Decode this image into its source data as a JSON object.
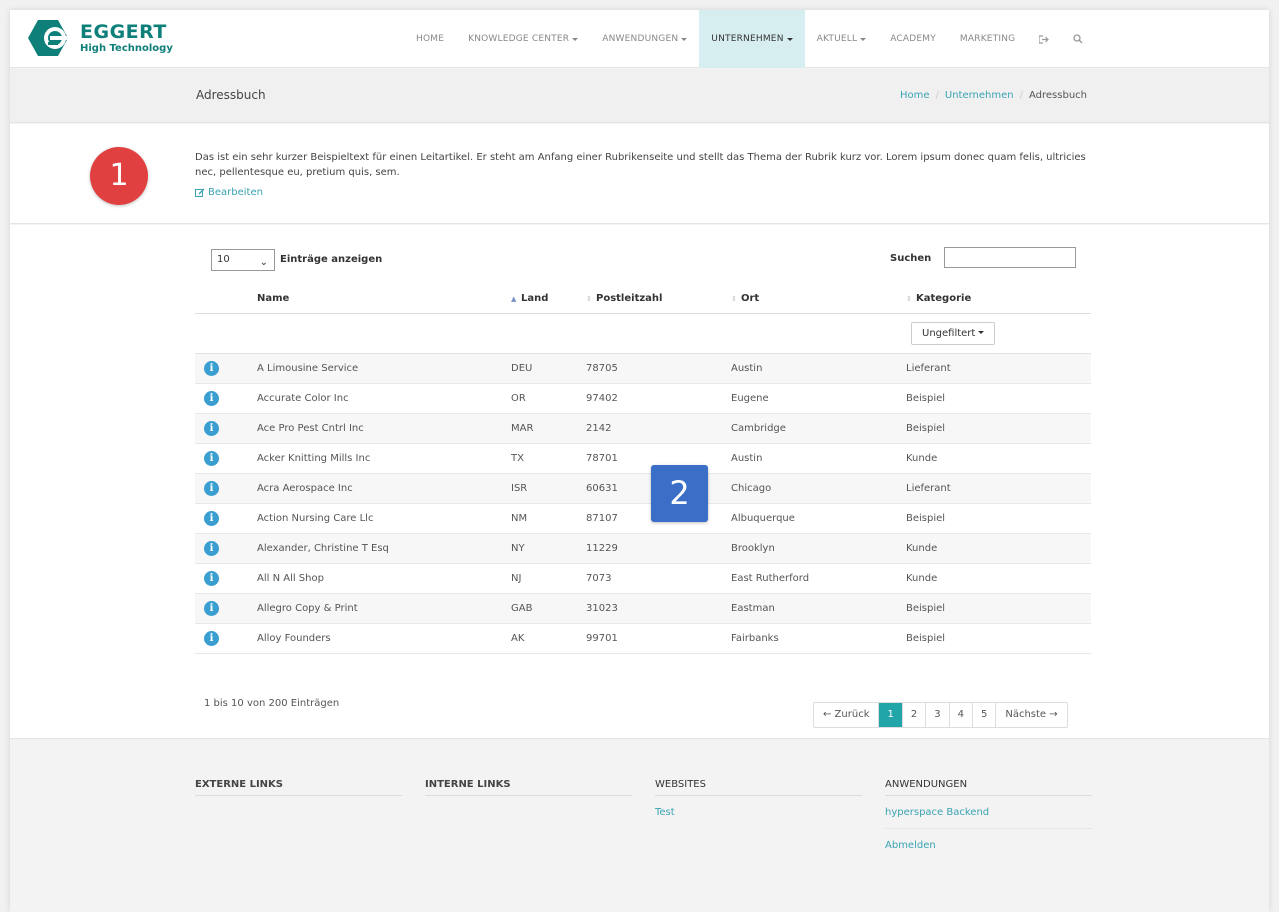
{
  "brand": {
    "name": "EGGERT",
    "tagline": "High Technology",
    "color": "#0f7f7a"
  },
  "nav": {
    "items": [
      {
        "label": "HOME",
        "dropdown": false,
        "active": false
      },
      {
        "label": "KNOWLEDGE CENTER",
        "dropdown": true,
        "active": false
      },
      {
        "label": "ANWENDUNGEN",
        "dropdown": true,
        "active": false
      },
      {
        "label": "UNTERNEHMEN",
        "dropdown": true,
        "active": true
      },
      {
        "label": "AKTUELL",
        "dropdown": true,
        "active": false
      },
      {
        "label": "ACADEMY",
        "dropdown": false,
        "active": false
      },
      {
        "label": "MARKETING",
        "dropdown": false,
        "active": false
      }
    ],
    "icons": [
      "sign-out-icon",
      "search-icon"
    ]
  },
  "header": {
    "title": "Adressbuch",
    "breadcrumb": [
      "Home",
      "Unternehmen",
      "Adressbuch"
    ]
  },
  "intro": {
    "badge": "1",
    "text": "Das ist ein sehr kurzer Beispieltext für einen Leitartikel. Er steht am Anfang einer Rubrikenseite und stellt das Thema der Rubrik kurz vor. Lorem ipsum donec quam felis, ultricies nec, pellentesque eu, pretium quis, sem.",
    "edit_label": "Bearbeiten"
  },
  "table": {
    "length_value": "10",
    "length_label": "Einträge anzeigen",
    "search_label": "Suchen",
    "search_value": "",
    "columns": [
      "Name",
      "Land",
      "Postleitzahl",
      "Ort",
      "Kategorie"
    ],
    "filter_label": "Ungefiltert",
    "rows": [
      {
        "name": "A Limousine Service",
        "land": "DEU",
        "plz": "78705",
        "ort": "Austin",
        "kategorie": "Lieferant"
      },
      {
        "name": "Accurate Color Inc",
        "land": "OR",
        "plz": "97402",
        "ort": "Eugene",
        "kategorie": "Beispiel"
      },
      {
        "name": "Ace Pro Pest Cntrl Inc",
        "land": "MAR",
        "plz": "2142",
        "ort": "Cambridge",
        "kategorie": "Beispiel"
      },
      {
        "name": "Acker Knitting Mills Inc",
        "land": "TX",
        "plz": "78701",
        "ort": "Austin",
        "kategorie": "Kunde"
      },
      {
        "name": "Acra Aerospace Inc",
        "land": "ISR",
        "plz": "60631",
        "ort": "Chicago",
        "kategorie": "Lieferant"
      },
      {
        "name": "Action Nursing Care Llc",
        "land": "NM",
        "plz": "87107",
        "ort": "Albuquerque",
        "kategorie": "Beispiel"
      },
      {
        "name": "Alexander, Christine T Esq",
        "land": "NY",
        "plz": "11229",
        "ort": "Brooklyn",
        "kategorie": "Kunde"
      },
      {
        "name": "All N All Shop",
        "land": "NJ",
        "plz": "7073",
        "ort": "East Rutherford",
        "kategorie": "Kunde"
      },
      {
        "name": "Allegro Copy & Print",
        "land": "GAB",
        "plz": "31023",
        "ort": "Eastman",
        "kategorie": "Beispiel"
      },
      {
        "name": "Alloy Founders",
        "land": "AK",
        "plz": "99701",
        "ort": "Fairbanks",
        "kategorie": "Beispiel"
      }
    ],
    "info": "1 bis 10 von 200 Einträgen",
    "badge": "2"
  },
  "pagination": {
    "prev": "← Zurück",
    "pages": [
      "1",
      "2",
      "3",
      "4",
      "5"
    ],
    "active": "1",
    "next": "Nächste →",
    "accent": "#22a5a9"
  },
  "footer": {
    "columns": [
      {
        "title": "EXTERNE LINKS",
        "links": []
      },
      {
        "title": "INTERNE LINKS",
        "links": []
      },
      {
        "title": "WEBSITES",
        "links": [
          "Test"
        ]
      },
      {
        "title": "ANWENDUNGEN",
        "links": [
          "hyperspace Backend",
          "Abmelden"
        ]
      }
    ]
  }
}
